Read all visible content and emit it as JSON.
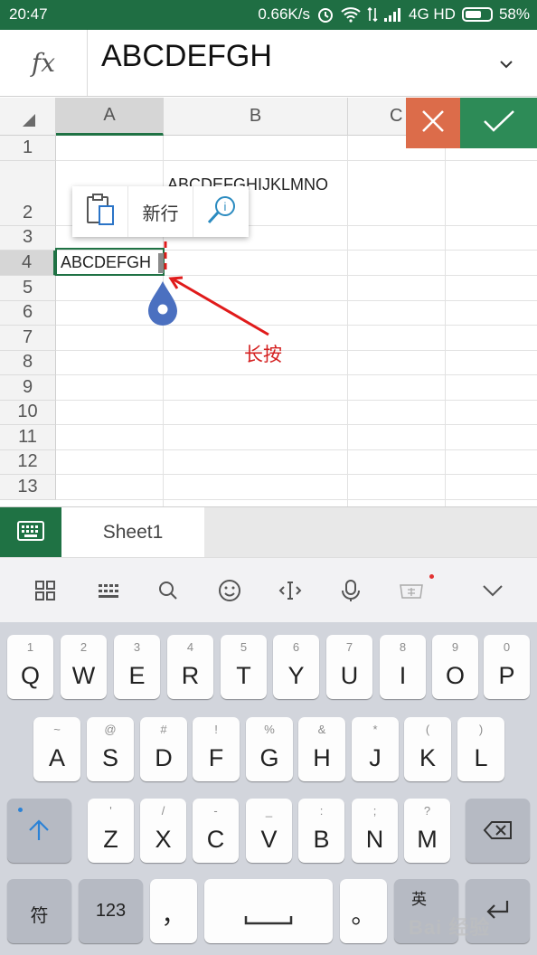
{
  "status_bar": {
    "time": "20:47",
    "speed": "0.66K/s",
    "network": "4G HD",
    "battery": "58%"
  },
  "formula_bar": {
    "fx_label": "fx",
    "value": "ABCDEFGH"
  },
  "sheet": {
    "columns": [
      "A",
      "B",
      "C"
    ],
    "rows": [
      "1",
      "2",
      "3",
      "4",
      "5",
      "6",
      "7",
      "8",
      "9",
      "10",
      "11",
      "12",
      "13"
    ],
    "selected_column": "A",
    "selected_row": "4",
    "cells": {
      "B2": "ABCDEFGHIJKLMNO",
      "A4": "ABCDEFGH"
    }
  },
  "context_menu": {
    "items": [
      {
        "icon": "paste-icon"
      },
      {
        "label": "新行"
      },
      {
        "icon": "smart-lookup-icon"
      }
    ]
  },
  "annotation": {
    "text": "长按"
  },
  "sheet_tabs": {
    "active": "Sheet1"
  },
  "ime_toolbar": {
    "icons": [
      "grid-icon",
      "keyboard-icon",
      "search-icon",
      "emoji-icon",
      "cursor-move-icon",
      "microphone-icon",
      "card-icon",
      "collapse-icon"
    ]
  },
  "keyboard": {
    "row1": [
      {
        "k": "Q",
        "h": "1"
      },
      {
        "k": "W",
        "h": "2"
      },
      {
        "k": "E",
        "h": "3"
      },
      {
        "k": "R",
        "h": "4"
      },
      {
        "k": "T",
        "h": "5"
      },
      {
        "k": "Y",
        "h": "6"
      },
      {
        "k": "U",
        "h": "7"
      },
      {
        "k": "I",
        "h": "8"
      },
      {
        "k": "O",
        "h": "9"
      },
      {
        "k": "P",
        "h": "0"
      }
    ],
    "row2": [
      {
        "k": "A",
        "h": "~"
      },
      {
        "k": "S",
        "h": "@"
      },
      {
        "k": "D",
        "h": "#"
      },
      {
        "k": "F",
        "h": "!"
      },
      {
        "k": "G",
        "h": "%"
      },
      {
        "k": "H",
        "h": "&"
      },
      {
        "k": "J",
        "h": "*"
      },
      {
        "k": "K",
        "h": "("
      },
      {
        "k": "L",
        "h": ")"
      }
    ],
    "row3": [
      {
        "k": "Z",
        "h": "'"
      },
      {
        "k": "X",
        "h": "/"
      },
      {
        "k": "C",
        "h": "-"
      },
      {
        "k": "V",
        "h": "_"
      },
      {
        "k": "B",
        "h": ":"
      },
      {
        "k": "N",
        "h": ";"
      },
      {
        "k": "M",
        "h": "?"
      }
    ],
    "symbols_label": "符",
    "numbers_label": "123",
    "comma_label": "，",
    "period_label": "。",
    "lang_label": "英"
  },
  "watermark": "Bai 经验"
}
